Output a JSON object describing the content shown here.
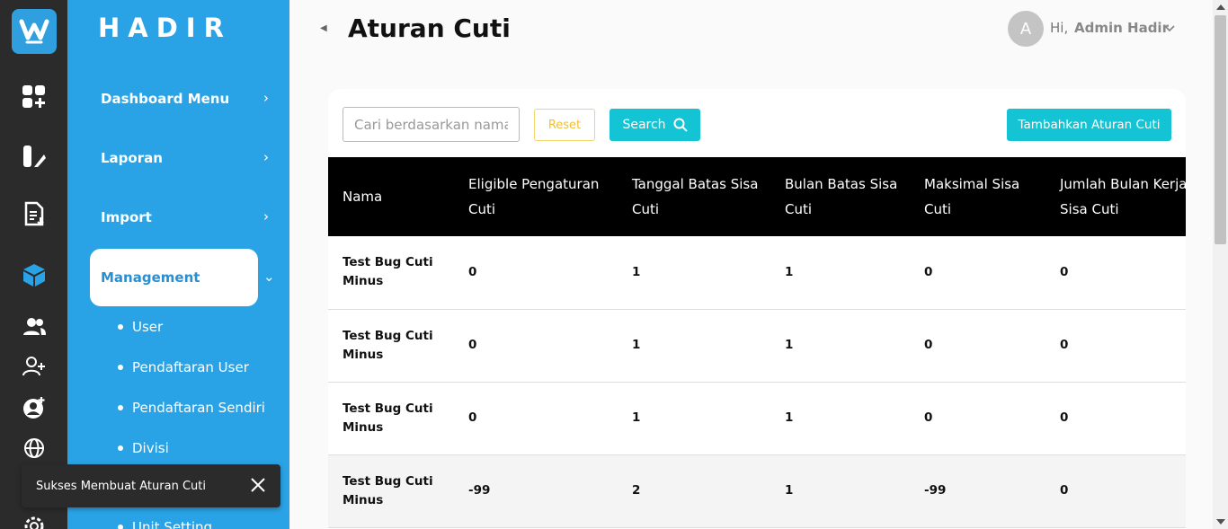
{
  "app": {
    "brand": "HADIR"
  },
  "header": {
    "title": "Aturan Cuti",
    "avatar_initial": "A",
    "greeting": "Hi,",
    "user_name": "Admin Hadir"
  },
  "sidebar": {
    "menus": [
      {
        "label": "Dashboard Menu"
      },
      {
        "label": "Laporan"
      },
      {
        "label": "Import"
      },
      {
        "label": "Management"
      }
    ],
    "submenus": [
      {
        "label": "User"
      },
      {
        "label": "Pendaftaran User"
      },
      {
        "label": "Pendaftaran Sendiri"
      },
      {
        "label": "Divisi"
      },
      {
        "label": "Unit Setting"
      }
    ]
  },
  "toolbar": {
    "search_placeholder": "Cari berdasarkan nama",
    "reset_label": "Reset",
    "search_label": "Search",
    "add_label": "Tambahkan Aturan Cuti"
  },
  "table": {
    "headers": [
      "Nama",
      "Eligible Pengaturan Cuti",
      "Tanggal Batas Sisa Cuti",
      "Bulan Batas Sisa Cuti",
      "Maksimal Sisa Cuti",
      "Jumlah Bulan Kerja Sisa Cuti"
    ],
    "rows": [
      [
        "Test Bug Cuti Minus",
        "0",
        "1",
        "1",
        "0",
        "0"
      ],
      [
        "Test Bug Cuti Minus",
        "0",
        "1",
        "1",
        "0",
        "0"
      ],
      [
        "Test Bug Cuti Minus",
        "0",
        "1",
        "1",
        "0",
        "0"
      ],
      [
        "Test Bug Cuti Minus",
        "-99",
        "2",
        "1",
        "-99",
        "0"
      ]
    ]
  },
  "toast": {
    "message": "Sukses Membuat Aturan Cuti"
  },
  "colors": {
    "sidebar": "#2aa3e6",
    "rail": "#2b2b2b",
    "accent": "#14c4d4",
    "reset": "#f0c030"
  }
}
